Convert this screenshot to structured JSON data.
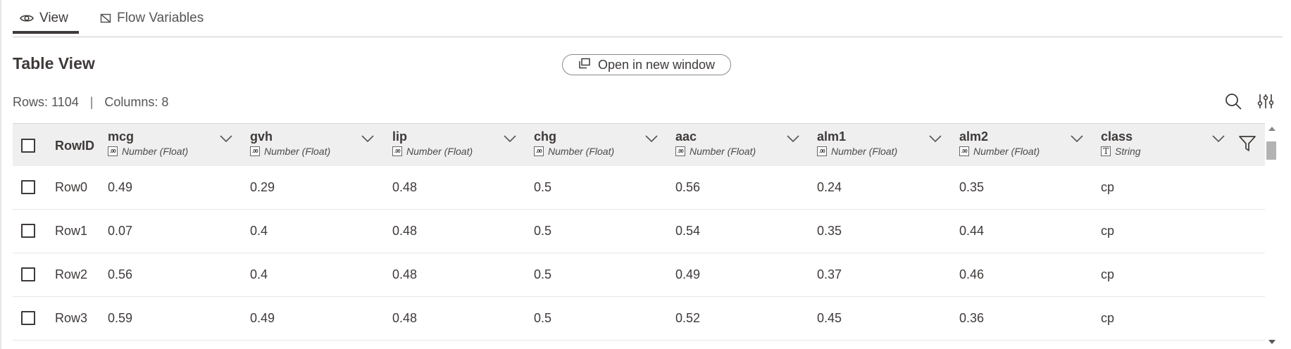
{
  "tabs": {
    "view": {
      "label": "View",
      "icon": "eye-icon"
    },
    "flow": {
      "label": "Flow Variables",
      "icon": "flow-variables-icon"
    }
  },
  "header": {
    "title": "Table View",
    "open_button": "Open in new window",
    "rows_label": "Rows: 1104",
    "separator": "|",
    "columns_label": "Columns: 8"
  },
  "table": {
    "rowid_header": "RowID",
    "columns": [
      {
        "name": "mcg",
        "type": "Number (Float)",
        "type_icon": ".00"
      },
      {
        "name": "gvh",
        "type": "Number (Float)",
        "type_icon": ".00"
      },
      {
        "name": "lip",
        "type": "Number (Float)",
        "type_icon": ".00"
      },
      {
        "name": "chg",
        "type": "Number (Float)",
        "type_icon": ".00"
      },
      {
        "name": "aac",
        "type": "Number (Float)",
        "type_icon": ".00"
      },
      {
        "name": "alm1",
        "type": "Number (Float)",
        "type_icon": ".00"
      },
      {
        "name": "alm2",
        "type": "Number (Float)",
        "type_icon": ".00"
      },
      {
        "name": "class",
        "type": "String",
        "type_icon": "T"
      }
    ],
    "rows": [
      {
        "id": "Row0",
        "cells": [
          "0.49",
          "0.29",
          "0.48",
          "0.5",
          "0.56",
          "0.24",
          "0.35",
          "cp"
        ]
      },
      {
        "id": "Row1",
        "cells": [
          "0.07",
          "0.4",
          "0.48",
          "0.5",
          "0.54",
          "0.35",
          "0.44",
          "cp"
        ]
      },
      {
        "id": "Row2",
        "cells": [
          "0.56",
          "0.4",
          "0.48",
          "0.5",
          "0.49",
          "0.37",
          "0.46",
          "cp"
        ]
      },
      {
        "id": "Row3",
        "cells": [
          "0.59",
          "0.49",
          "0.48",
          "0.5",
          "0.52",
          "0.45",
          "0.36",
          "cp"
        ]
      }
    ]
  },
  "colors": {
    "text": "#3e3a39",
    "header_bg": "#efefef",
    "border": "#e6e6e6"
  }
}
